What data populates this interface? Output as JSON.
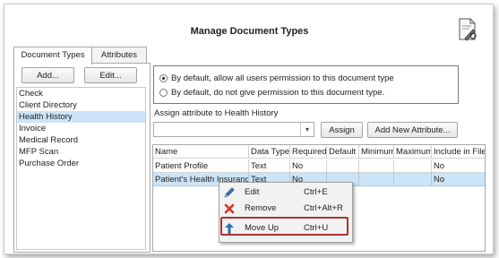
{
  "window": {
    "title": "Manage Document Types"
  },
  "tabs": [
    {
      "label": "Document Types"
    },
    {
      "label": "Attributes"
    }
  ],
  "left": {
    "add_label": "Add...",
    "edit_label": "Edit...",
    "items": [
      {
        "label": "Check"
      },
      {
        "label": "Client Directory"
      },
      {
        "label": "Health History"
      },
      {
        "label": "Invoice"
      },
      {
        "label": "Medical Record"
      },
      {
        "label": "MFP Scan"
      },
      {
        "label": "Purchase Order"
      }
    ],
    "selected": "Health History"
  },
  "permissions": {
    "option_allow": "By default, allow all users permission to this document type",
    "option_deny": "By default, do not give permission to this document type.",
    "selected": "allow"
  },
  "assign": {
    "label": "Assign attribute to Health History",
    "combo_value": "",
    "assign_label": "Assign",
    "add_new_label": "Add New Attribute..."
  },
  "grid": {
    "columns": [
      "Name",
      "Data Type",
      "Required",
      "Default",
      "Minimum",
      "Maximum",
      "Include in File"
    ],
    "rows": [
      [
        "Patient Profile",
        "Text",
        "No",
        "",
        "",
        "",
        "No"
      ],
      [
        "Patient's Health Insurance",
        "Text",
        "No",
        "",
        "",
        "",
        "No"
      ]
    ]
  },
  "context_menu": {
    "items": [
      {
        "label": "Edit",
        "shortcut": "Ctrl+E",
        "icon": "pencil-icon"
      },
      {
        "label": "Remove",
        "shortcut": "Ctrl+Alt+R",
        "icon": "red-x-icon"
      },
      {
        "label": "Move Up",
        "shortcut": "Ctrl+U",
        "icon": "arrow-up-icon"
      }
    ]
  },
  "colors": {
    "selection": "#cce4f7",
    "highlight_border": "#b03030",
    "arrow_blue": "#2a6fb8",
    "remove_red": "#d2352a"
  }
}
